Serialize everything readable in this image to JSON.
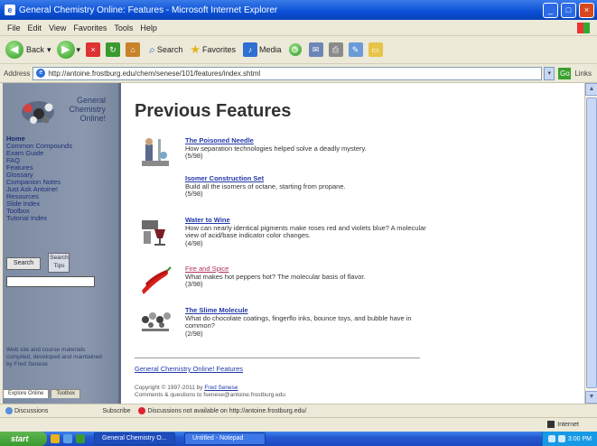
{
  "window": {
    "title": "General Chemistry Online: Features - Microsoft Internet Explorer",
    "app_icon": "e",
    "controls": {
      "minimize": "_",
      "maximize": "□",
      "close": "×"
    }
  },
  "menu": [
    "File",
    "Edit",
    "View",
    "Favorites",
    "Tools",
    "Help"
  ],
  "toolbar": {
    "back": "Back",
    "search": "Search",
    "favorites": "Favorites",
    "media": "Media"
  },
  "address": {
    "label": "Address",
    "url": "http://antoine.frostburg.edu/chem/senese/101/features/index.shtml",
    "go": "Go",
    "links": "Links"
  },
  "sidebar": {
    "logo_text": [
      "General",
      "Chemistry",
      "Online!"
    ],
    "nav": [
      "Home",
      "Common Compounds",
      "Exam Guide",
      "FAQ",
      "Features",
      "Glossary",
      "Companion Notes",
      "Just Ask Antoine!",
      "Resources",
      "Slide Index",
      "Toolbox",
      "Tutorial Index"
    ],
    "search_button": "Search",
    "search_tips": "Search Tips",
    "blurb": "Web site and course materials compiled, developed and maintained by Fred Senese"
  },
  "page": {
    "heading": "Previous Features",
    "features": [
      {
        "title": "The Poisoned Needle",
        "desc": "How separation technologies helped solve a deadly mystery.",
        "date": "(5/98)",
        "visited": false,
        "thumb": "chemist-icon"
      },
      {
        "title": "Isomer Construction Set",
        "desc": "Build all the isomers of octane, starting from propane.",
        "date": "(5/98)",
        "visited": false,
        "thumb": ""
      },
      {
        "title": "Water to Wine",
        "desc": "How can nearly identical pigments make roses red and violets blue? A molecular view of acid/base indicator color changes.",
        "date": "(4/98)",
        "visited": false,
        "thumb": "wine-glass-icon"
      },
      {
        "title": "Fire and Spice",
        "desc": "What makes hot peppers hot? The molecular basis of flavor.",
        "date": "(3/98)",
        "visited": true,
        "thumb": "chili-pepper-icon"
      },
      {
        "title": "The Slime Molecule",
        "desc": "What do chocolate coatings, fingerflo inks, bounce toys, and bubble have in common?",
        "date": "(2/98)",
        "visited": false,
        "thumb": "molecule-icon"
      }
    ],
    "footer_link": "General Chemistry Online! Features",
    "copyright": "Copyright © 1997-2011 by",
    "copyright_author": "Fred Senese",
    "copyright_line2": "Comments & questions to fsenese@antoine.frostburg.edu"
  },
  "tabs": [
    "Explore Online",
    "Toolbox"
  ],
  "linksbar": {
    "item1": "Discussions",
    "item2": "Subscribe",
    "warning": "Discussions not available on http://antoine.frostburg.edu/"
  },
  "status": {
    "left": "",
    "zone": "Internet"
  },
  "taskbar": {
    "start": "start",
    "tasks": [
      "General Chemistry O...",
      "Untitled - Notepad"
    ],
    "clock": "3:00 PM"
  }
}
